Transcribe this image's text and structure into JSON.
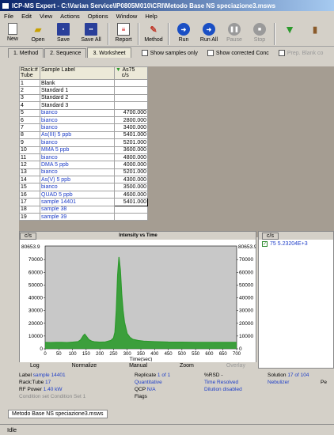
{
  "window": {
    "title": "ICP-MS Expert - C:\\Varian Service\\IP0805M010\\CRI\\Metodo Base NS speciazione3.msws"
  },
  "menu": [
    "File",
    "Edit",
    "View",
    "Actions",
    "Options",
    "Window",
    "Help"
  ],
  "toolbar": {
    "new": "New",
    "open": "Open",
    "save": "Save",
    "save_all": "Save All",
    "report": "Report",
    "method": "Method",
    "run": "Run",
    "run_all": "Run All",
    "pause": "Pause",
    "stop": "Stop"
  },
  "tabs": [
    "1. Method",
    "2. Sequence",
    "3. Worksheet"
  ],
  "options": {
    "show_samples_only": "Show samples only",
    "show_corrected_conc": "Show corrected Conc",
    "prep_blank": "Prep. Blank co"
  },
  "table": {
    "header_rack": "Rack:Tube",
    "header_rack_line1": "Rack:#",
    "header_rack_line2": "Tube",
    "header_label": "Sample Label",
    "header_element": "As75",
    "header_unit": "c/s",
    "rows": [
      {
        "n": "1",
        "label": "Blank",
        "value": "",
        "blue": false
      },
      {
        "n": "2",
        "label": "Standard 1",
        "value": "",
        "blue": false
      },
      {
        "n": "3",
        "label": "Standard 2",
        "value": "",
        "blue": false
      },
      {
        "n": "4",
        "label": "Standard 3",
        "value": "",
        "blue": false
      },
      {
        "n": "5",
        "label": "bianco",
        "value": "4700.000",
        "blue": true
      },
      {
        "n": "6",
        "label": "bianco",
        "value": "2800.000",
        "blue": true
      },
      {
        "n": "7",
        "label": "bianco",
        "value": "3400.000",
        "blue": true
      },
      {
        "n": "8",
        "label": "As(III) 5 ppb",
        "value": "5401.000",
        "blue": true
      },
      {
        "n": "9",
        "label": "bianco",
        "value": "5201.000",
        "blue": true
      },
      {
        "n": "10",
        "label": "MMA 5 ppb",
        "value": "3600.000",
        "blue": true
      },
      {
        "n": "11",
        "label": "bianco",
        "value": "4800.000",
        "blue": true
      },
      {
        "n": "12",
        "label": "DMA 5 ppb",
        "value": "4000.000",
        "blue": true
      },
      {
        "n": "13",
        "label": "bianco",
        "value": "5201.000",
        "blue": true
      },
      {
        "n": "14",
        "label": "As(V) 5 ppb",
        "value": "4300.000",
        "blue": true
      },
      {
        "n": "15",
        "label": "bianco",
        "value": "3500.000",
        "blue": true
      },
      {
        "n": "16",
        "label": "QUAD 5 ppb",
        "value": "4600.000",
        "blue": true
      },
      {
        "n": "17",
        "label": "sample 14401",
        "value": "5401.000",
        "blue": true
      },
      {
        "n": "18",
        "label": "sample 38",
        "value": "",
        "blue": true
      },
      {
        "n": "19",
        "label": "sample 39",
        "value": "",
        "blue": true
      }
    ]
  },
  "chart": {
    "unit_left": "c/s",
    "unit_right": "c/s",
    "title": "Intensity vs Time",
    "legend": "75  5.23204E+3",
    "max_left": "80653.9",
    "max_right": "80653.9",
    "y_ticks": [
      "0",
      "10000",
      "20000",
      "30000",
      "40000",
      "50000",
      "60000",
      "70000"
    ],
    "x_ticks": [
      "0",
      "50",
      "100",
      "150",
      "200",
      "250",
      "300",
      "350",
      "400",
      "450",
      "500",
      "550",
      "600",
      "650",
      "700"
    ],
    "xlabel": "Time(sec)",
    "controls": {
      "log": "Log",
      "normalize": "Normalize",
      "manual": "Manual",
      "zoom": "Zoom",
      "overlay": "Overlay"
    }
  },
  "chart_data": {
    "type": "line",
    "title": "Intensity vs Time",
    "xlabel": "Time(sec)",
    "ylabel": "c/s",
    "xlim": [
      0,
      700
    ],
    "ylim": [
      0,
      80653.9
    ],
    "series": [
      {
        "name": "75",
        "color": "#2c9a2c",
        "x": [
          0,
          20,
          40,
          60,
          80,
          100,
          120,
          130,
          140,
          145,
          150,
          160,
          170,
          180,
          200,
          220,
          240,
          250,
          255,
          260,
          265,
          270,
          275,
          280,
          285,
          290,
          300,
          310,
          320,
          340,
          360,
          400,
          450,
          500,
          550,
          600,
          650,
          700
        ],
        "y": [
          5000,
          4900,
          5100,
          5000,
          4900,
          5200,
          5600,
          7000,
          10500,
          11500,
          10000,
          7200,
          6000,
          5500,
          5200,
          5400,
          6500,
          8500,
          13000,
          30000,
          58000,
          72000,
          62000,
          43000,
          30000,
          21000,
          12000,
          9000,
          7500,
          6500,
          6000,
          5600,
          5300,
          5200,
          5100,
          5100,
          5000,
          5000
        ]
      }
    ]
  },
  "info": {
    "label_k": "Label",
    "label_v": "sample 14401",
    "rack_k": "Rack:Tube",
    "rack_v": "17",
    "rf_k": "RF Power",
    "rf_v": "1.40 kW",
    "cond_k": "Condition set",
    "cond_v": "Condition Set 1",
    "replicate_k": "Replicate",
    "replicate_v": "1 of 1",
    "quant": "Quantitative",
    "qcp_k": "QCP",
    "qcp_v": "N/A",
    "flags_k": "Flags",
    "rsd_k": "%RSD",
    "rsd_v": "-",
    "time_resolved": "Time Resolved",
    "dilution": "Dilution disabled",
    "solution_k": "Solution",
    "solution_v": "17 of 104",
    "nebulizer": "Nebulizer",
    "pe": "Pe"
  },
  "document_tab": "Metodo Base NS speciazione3.msws",
  "status": "Idle"
}
